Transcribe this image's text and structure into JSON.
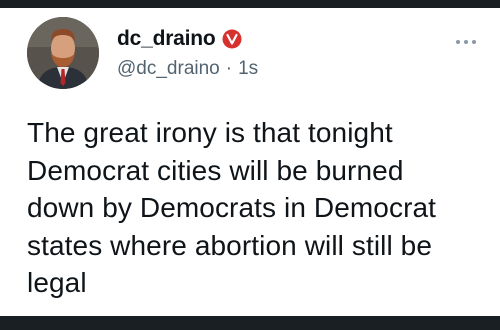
{
  "tweet": {
    "author": {
      "display_name": "dc_draino",
      "handle": "@dc_draino",
      "verified_icon": "verified-badge-icon",
      "avatar": "profile-photo"
    },
    "separator": "·",
    "timestamp": "1s",
    "more_icon": "more-options-icon",
    "text": "The great irony is that tonight\nDemocrat cities will be burned\ndown by Democrats in Democrat\nstates where abortion will still be\nlegal"
  },
  "colors": {
    "background": "#1a1f24",
    "card": "#ffffff",
    "text_primary": "#0f1419",
    "text_secondary": "#536471",
    "verified_badge": "#d6312f"
  }
}
